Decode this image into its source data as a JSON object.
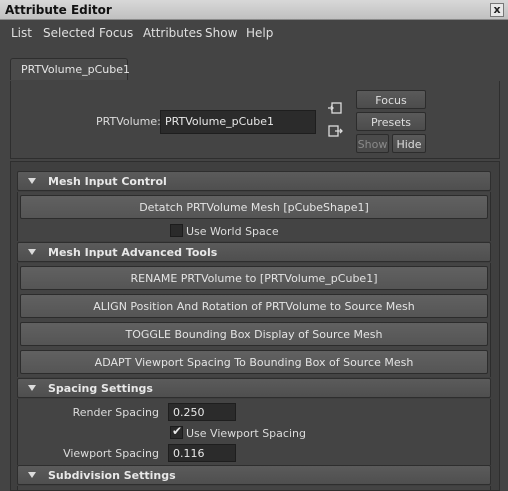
{
  "window": {
    "title": "Attribute Editor",
    "close_glyph": "x"
  },
  "menu": [
    "List",
    "Selected",
    "Focus",
    "Attributes",
    "Show",
    "Help"
  ],
  "tabs": [
    {
      "label": "PRTVolume_pCube1"
    }
  ],
  "header": {
    "field_label": "PRTVolume:",
    "field_value": "PRTVolume_pCube1",
    "buttons": {
      "focus": "Focus",
      "presets": "Presets",
      "show": "Show",
      "hide": "Hide"
    },
    "icons": [
      "input-connection-icon",
      "output-connection-icon"
    ]
  },
  "sections": {
    "mesh_input_control": {
      "title": "Mesh Input Control",
      "detatch_button": "Detatch PRTVolume Mesh [pCubeShape1]",
      "use_world_space": {
        "label": "Use World Space",
        "checked": false
      }
    },
    "mesh_input_advanced": {
      "title": "Mesh Input Advanced Tools",
      "buttons": [
        "RENAME PRTVolume to [PRTVolume_pCube1]",
        "ALIGN Position And Rotation of PRTVolume to Source Mesh",
        "TOGGLE Bounding Box Display of Source Mesh",
        "ADAPT Viewport Spacing To Bounding Box of Source Mesh"
      ]
    },
    "spacing": {
      "title": "Spacing Settings",
      "render_spacing": {
        "label": "Render Spacing",
        "value": "0.250"
      },
      "use_viewport_spacing": {
        "label": "Use Viewport Spacing",
        "checked": true
      },
      "viewport_spacing": {
        "label": "Viewport Spacing",
        "value": "0.116"
      }
    },
    "subdivision": {
      "title": "Subdivision Settings"
    }
  }
}
